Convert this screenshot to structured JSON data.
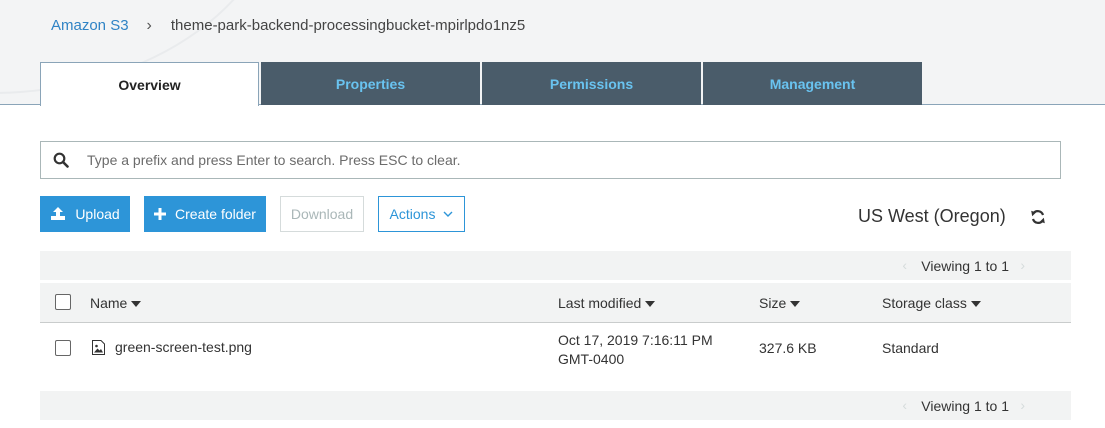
{
  "breadcrumb": {
    "root": "Amazon S3",
    "separator": "›",
    "bucket": "theme-park-backend-processingbucket-mpirlpdo1nz5"
  },
  "tabs": [
    {
      "label": "Overview",
      "active": true
    },
    {
      "label": "Properties",
      "active": false
    },
    {
      "label": "Permissions",
      "active": false
    },
    {
      "label": "Management",
      "active": false
    }
  ],
  "search": {
    "placeholder": "Type a prefix and press Enter to search. Press ESC to clear.",
    "value": "",
    "icon": "search-icon"
  },
  "toolbar": {
    "upload_label": "Upload",
    "create_folder_label": "Create folder",
    "download_label": "Download",
    "actions_label": "Actions"
  },
  "region": "US West (Oregon)",
  "pagination": {
    "viewing_text": "Viewing 1 to 1"
  },
  "table": {
    "columns": [
      "Name",
      "Last modified",
      "Size",
      "Storage class"
    ],
    "rows": [
      {
        "name": "green-screen-test.png",
        "last_modified_line1": "Oct 17, 2019 7:16:11 PM",
        "last_modified_line2": "GMT-0400",
        "size": "327.6 KB",
        "storage_class": "Standard",
        "checked": false
      }
    ]
  },
  "colors": {
    "accent": "#2d95d8",
    "tab_bg": "#4a5c6a",
    "tab_text": "#69c3f0",
    "link": "#2f83c5"
  }
}
